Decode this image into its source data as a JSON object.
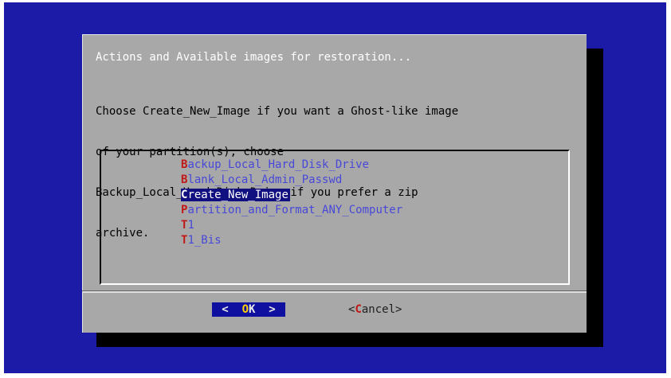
{
  "dialog": {
    "title": "Actions and Available images for restoration...",
    "prompt_lines": [
      "Choose Create_New_Image if you want a Ghost-like image",
      "of your partition(s), choose",
      "Backup_Local_Hard_Disk_Drive if you prefer a zip",
      "archive."
    ]
  },
  "menu": {
    "selected_index": 2,
    "items": [
      {
        "hotkey": "B",
        "rest": "ackup_Local_Hard_Disk_Drive"
      },
      {
        "hotkey": "B",
        "rest": "lank_Local_Admin_Passwd"
      },
      {
        "hotkey": "C",
        "rest": "reate_New_Image"
      },
      {
        "hotkey": "P",
        "rest": "artition_and_Format_ANY_Computer"
      },
      {
        "hotkey": "T",
        "rest": "1"
      },
      {
        "hotkey": "T",
        "rest": "1_Bis"
      }
    ]
  },
  "buttons": {
    "ok": {
      "left": "<  ",
      "hotkey": "O",
      "rest": "K",
      "right": "  >"
    },
    "cancel": {
      "left": "<",
      "hotkey": "C",
      "rest": "ancel",
      "right": ">"
    }
  },
  "colors": {
    "background_blue": "#1b1ba8",
    "dialog_gray": "#a8a8a8",
    "hotkey_red": "#c01818",
    "menu_blue_text": "#4848d8",
    "selection_navy": "#101080"
  }
}
